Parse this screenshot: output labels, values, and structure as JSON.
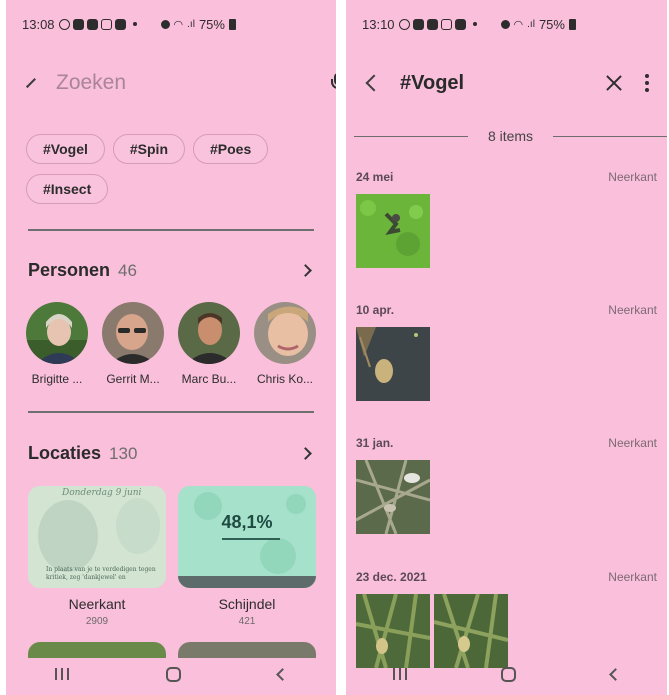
{
  "left": {
    "status": {
      "time": "13:08",
      "battery": "75%"
    },
    "search": {
      "placeholder": "Zoeken"
    },
    "tags": [
      "#Vogel",
      "#Spin",
      "#Poes",
      "#Insect"
    ],
    "people": {
      "title": "Personen",
      "count": "46",
      "items": [
        {
          "name": "Brigitte ..."
        },
        {
          "name": "Gerrit M..."
        },
        {
          "name": "Marc Bu..."
        },
        {
          "name": "Chris Ko..."
        }
      ]
    },
    "locations": {
      "title": "Locaties",
      "count": "130",
      "items": [
        {
          "name": "Neerkant",
          "count": "2909",
          "thumb_text_top": "Donderdag 9 juni",
          "thumb_text_bottom": "In plaats van je te verdedigen tegen kritiek, zeg 'dankjewel' en"
        },
        {
          "name": "Schijndel",
          "count": "421",
          "thumb_text": "48,1%"
        }
      ]
    }
  },
  "right": {
    "status": {
      "time": "13:10",
      "battery": "75%"
    },
    "album": {
      "title": "#Vogel",
      "count_label": "8 items"
    },
    "groups": [
      {
        "date": "24 mei",
        "location": "Neerkant"
      },
      {
        "date": "10 apr.",
        "location": "Neerkant"
      },
      {
        "date": "31 jan.",
        "location": "Neerkant"
      },
      {
        "date": "23 dec. 2021",
        "location": "Neerkant"
      }
    ]
  },
  "colors": {
    "background": "#f9bfdb",
    "chip_border": "#d79bb8",
    "divider": "#6f6f6f"
  }
}
